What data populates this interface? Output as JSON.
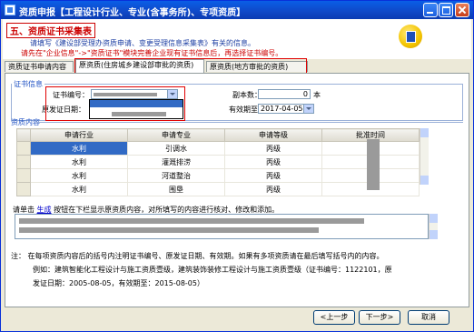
{
  "window": {
    "title": "资质申报【工程设计行业、专业(含事务所)、专项资质】"
  },
  "header": {
    "section_title": "五、资质证书采集表",
    "line1": "请填写《建设部受理办资质申请、变更受理信息采集表》有关的信息。",
    "line2": "请先在\"企业信息\"->\"资质证书\"模块完善企业现有证书信息后，再选择证书编号。"
  },
  "tabs": [
    {
      "label": "资质证书申请内容"
    },
    {
      "label": "原资质(住房城乡建设部审批的资质)"
    },
    {
      "label": "原资质(地方审批的资质)"
    }
  ],
  "cert": {
    "legend": "证书信息",
    "number_label": "证书编号：",
    "date_label": "原发证日期：",
    "copies_label": "副本数：",
    "copies_value": "0",
    "copies_unit": "本",
    "expiry_label": "有效期至：",
    "expiry_value": "2017-04-05"
  },
  "qual": {
    "section": "资质内容",
    "headers": [
      "申请行业",
      "申请专业",
      "申请等级",
      "批准时间"
    ],
    "rows": [
      [
        "水利",
        "引调水",
        "丙级",
        ""
      ],
      [
        "水利",
        "灌溉排涝",
        "丙级",
        ""
      ],
      [
        "水利",
        "河道整治",
        "丙级",
        ""
      ],
      [
        "水利",
        "围垦",
        "丙级",
        ""
      ]
    ]
  },
  "generate": {
    "prefix": "请单击",
    "link": "生成",
    "suffix": "按钮在下栏显示原资质内容，对所填写的内容进行核对、修改和添加。"
  },
  "note": {
    "line1": "注：   在每项资质内容后的括号内注明证书编号、原发证日期、有效期。如果有多项资质请在最后填写括号内的内容。",
    "line2": "例如：建筑智能化工程设计与施工资质壹级，建筑装饰装修工程设计与施工资质壹级（证书编号：1122101，原",
    "line3": "发证日期：2005-08-05，有效期至：2015-08-05）"
  },
  "buttons": {
    "prev": "<上一步",
    "next": "下一步>",
    "cancel": "取消"
  }
}
